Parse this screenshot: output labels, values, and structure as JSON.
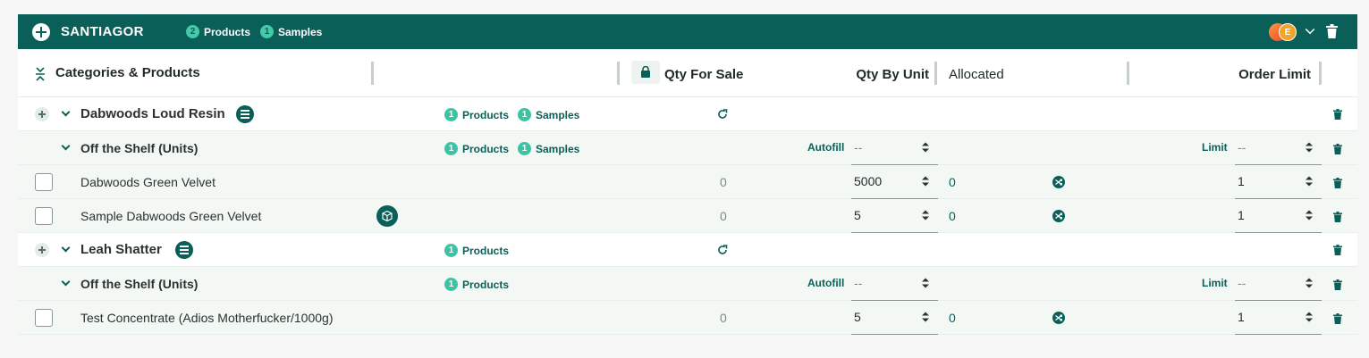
{
  "header": {
    "store_name": "SANTIAGOR",
    "products_count": "2",
    "products_label": "Products",
    "samples_count": "1",
    "samples_label": "Samples",
    "avatar_initial": "E"
  },
  "columns": {
    "categories": "Categories & Products",
    "qty_for_sale": "Qty For Sale",
    "qty_by_unit": "Qty By Unit",
    "allocated": "Allocated",
    "order_limit": "Order Limit"
  },
  "groups": [
    {
      "name": "Dabwoods Loud Resin",
      "products_count": "1",
      "products_label": "Products",
      "samples_count": "1",
      "samples_label": "Samples",
      "subgroup": {
        "name": "Off the Shelf (Units)",
        "products_count": "1",
        "products_label": "Products",
        "samples_count": "1",
        "samples_label": "Samples",
        "autofill_label": "Autofill",
        "autofill_value": "--",
        "limit_label": "Limit",
        "limit_value": "--"
      },
      "items": [
        {
          "name": "Dabwoods Green Velvet",
          "qty_for_sale": "0",
          "qty_by_unit": "5000",
          "allocated": "0",
          "order_limit": "1",
          "sample": false
        },
        {
          "name": "Sample Dabwoods Green Velvet",
          "qty_for_sale": "0",
          "qty_by_unit": "5",
          "allocated": "0",
          "order_limit": "1",
          "sample": true
        }
      ]
    },
    {
      "name": "Leah Shatter",
      "products_count": "1",
      "products_label": "Products",
      "subgroup": {
        "name": "Off the Shelf (Units)",
        "products_count": "1",
        "products_label": "Products",
        "autofill_label": "Autofill",
        "autofill_value": "--",
        "limit_label": "Limit",
        "limit_value": "--"
      },
      "items": [
        {
          "name": "Test Concentrate (Adios Motherfucker/1000g)",
          "qty_for_sale": "0",
          "qty_by_unit": "5",
          "allocated": "0",
          "order_limit": "1",
          "sample": false
        }
      ]
    }
  ],
  "icons": {
    "add": "plus-circle-icon",
    "expand": "chevron-down-icon",
    "delete": "trash-icon",
    "lock": "lock-icon",
    "refresh": "refresh-icon",
    "shuffle": "shuffle-icon",
    "menu": "list-menu-icon",
    "sample_box": "sample-box-icon"
  },
  "colors": {
    "header_bg": "#0b5f59",
    "accent": "#3cc3a3",
    "row_light": "#f3f8f4"
  }
}
